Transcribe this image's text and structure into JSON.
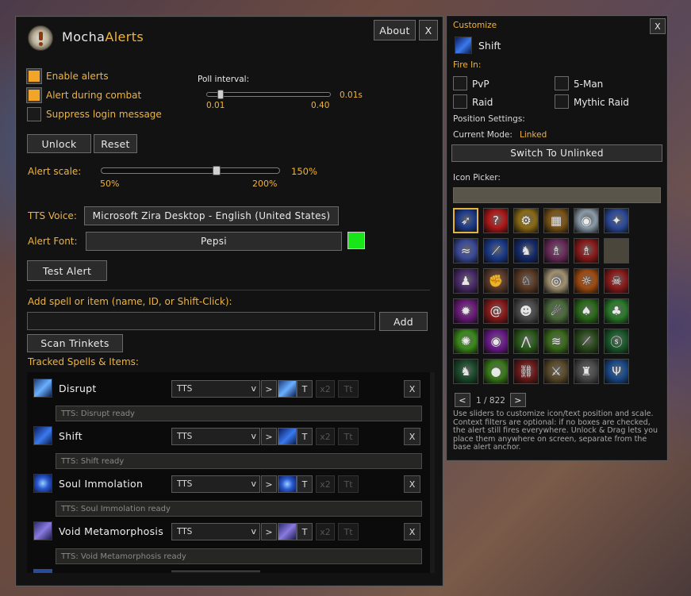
{
  "main": {
    "title_part1": "Mocha",
    "title_part2": "Alerts",
    "about_label": "About",
    "close_label": "X",
    "options": {
      "enable_alerts": "Enable alerts",
      "alert_during_combat": "Alert during combat",
      "suppress_login": "Suppress login message"
    },
    "poll": {
      "label": "Poll interval:",
      "min": "0.01",
      "max": "0.40",
      "value": "0.01s"
    },
    "unlock_label": "Unlock",
    "reset_label": "Reset",
    "alert_scale": {
      "label": "Alert scale:",
      "min": "50%",
      "max": "200%",
      "value": "150%"
    },
    "tts_voice": {
      "label": "TTS Voice:",
      "value": "Microsoft Zira Desktop - English (United States)"
    },
    "alert_font": {
      "label": "Alert Font:",
      "value": "Pepsi",
      "color": "#19e619"
    },
    "test_alert_label": "Test Alert",
    "add_label": "Add spell or item (name, ID, or Shift-Click):",
    "add_button": "Add",
    "scan_trinkets": "Scan Trinkets",
    "tracked_label": "Tracked Spells & Items:",
    "tracked": [
      {
        "name": "Disrupt",
        "mode": "TTS",
        "tts": "TTS: Disrupt ready",
        "icon": "disrupt-icon"
      },
      {
        "name": "Shift",
        "mode": "TTS",
        "tts": "TTS: Shift ready",
        "icon": "shift-icon"
      },
      {
        "name": "Soul Immolation",
        "mode": "TTS",
        "tts": "TTS: Soul Immolation ready",
        "icon": "soul-immolation-icon"
      },
      {
        "name": "Void Metamorphosis",
        "mode": "TTS",
        "tts": "TTS: Void Metamorphosis ready",
        "icon": "void-metamorphosis-icon"
      }
    ],
    "row_buttons": {
      "arrow": ">",
      "t": "T",
      "x2": "x2",
      "tt": "Tt",
      "remove": "X",
      "chevron": "v"
    }
  },
  "customize": {
    "title": "Customize",
    "close_label": "X",
    "spell_name": "Shift",
    "fire_in_label": "Fire In:",
    "fire_in": [
      "PvP",
      "5-Man",
      "Raid",
      "Mythic Raid"
    ],
    "position_label": "Position Settings:",
    "current_mode_label": "Current Mode:",
    "current_mode_value": "Linked",
    "switch_label": "Switch To Unlinked",
    "icon_picker_label": "Icon Picker:",
    "pager": {
      "prev": "<",
      "text": "1 / 822",
      "next": ">"
    },
    "help": "Use sliders to customize icon/text position and scale. Context filters are optional: if no boxes are checked, the alert still fires everywhere. Unlock & Drag lets you place them anywhere on screen, separate from the base alert anchor.",
    "icons": [
      {
        "name": "shift",
        "color": "#1e3c8c",
        "glyph": "➶"
      },
      {
        "name": "question",
        "color": "#b01818",
        "glyph": "?"
      },
      {
        "name": "gear",
        "color": "#8a6a14",
        "glyph": "⚙"
      },
      {
        "name": "banner",
        "color": "#7a5416",
        "glyph": "▦"
      },
      {
        "name": "disc",
        "color": "#8a9aa8",
        "glyph": "◉"
      },
      {
        "name": "sword-strike",
        "color": "#2c4a9a",
        "glyph": "✦"
      },
      {
        "name": "serpent",
        "color": "#3a4a9a",
        "glyph": "≈"
      },
      {
        "name": "blades",
        "color": "#1a3a8a",
        "glyph": "⟋"
      },
      {
        "name": "demon-blue",
        "color": "#142a6a",
        "glyph": "♞"
      },
      {
        "name": "potion-purple",
        "color": "#6a2a5a",
        "glyph": "♗"
      },
      {
        "name": "potion-red",
        "color": "#8a1a1a",
        "glyph": "♗"
      },
      {
        "name": "empty",
        "color": "#4a463c",
        "glyph": ""
      },
      {
        "name": "demon-purple",
        "color": "#4a2a6a",
        "glyph": "♟"
      },
      {
        "name": "fists",
        "color": "#5a3a2a",
        "glyph": "✊"
      },
      {
        "name": "beast",
        "color": "#5a3a24",
        "glyph": "♘"
      },
      {
        "name": "eye",
        "color": "#a09070",
        "glyph": "◎"
      },
      {
        "name": "sun-rune",
        "color": "#a04a10",
        "glyph": "☼"
      },
      {
        "name": "skull-cross",
        "color": "#8a1a1a",
        "glyph": "☠"
      },
      {
        "name": "fel-purple",
        "color": "#6a1a7a",
        "glyph": "✹"
      },
      {
        "name": "spiral",
        "color": "#8a1a1a",
        "glyph": "@"
      },
      {
        "name": "ghost-face",
        "color": "#4a4a4a",
        "glyph": "☻"
      },
      {
        "name": "claw",
        "color": "#4a6a3a",
        "glyph": "☄"
      },
      {
        "name": "fel-demon",
        "color": "#2a6a1a",
        "glyph": "♠"
      },
      {
        "name": "green-claw",
        "color": "#2a7a2a",
        "glyph": "♣"
      },
      {
        "name": "fel-burst",
        "color": "#3a8a1a",
        "glyph": "✺"
      },
      {
        "name": "fel-eye",
        "color": "#6a1a8a",
        "glyph": "◉"
      },
      {
        "name": "fel-spikes",
        "color": "#2a5a1a",
        "glyph": "⋀"
      },
      {
        "name": "fel-wave",
        "color": "#3a6a1a",
        "glyph": "≋"
      },
      {
        "name": "fel-slash",
        "color": "#2a4a1a",
        "glyph": "⟋"
      },
      {
        "name": "fel-serpent",
        "color": "#1a5a2a",
        "glyph": "ⓢ"
      },
      {
        "name": "fel-beast",
        "color": "#1a4a2a",
        "glyph": "♞"
      },
      {
        "name": "fel-blob",
        "color": "#3a7a1a",
        "glyph": "●"
      },
      {
        "name": "chain",
        "color": "#6a1a1a",
        "glyph": "⛓"
      },
      {
        "name": "axe-gold",
        "color": "#5a4a2a",
        "glyph": "⚔"
      },
      {
        "name": "gray-beast",
        "color": "#4a4a4a",
        "glyph": "♜"
      },
      {
        "name": "blue-rune",
        "color": "#1a4a8a",
        "glyph": "Ψ"
      }
    ]
  }
}
